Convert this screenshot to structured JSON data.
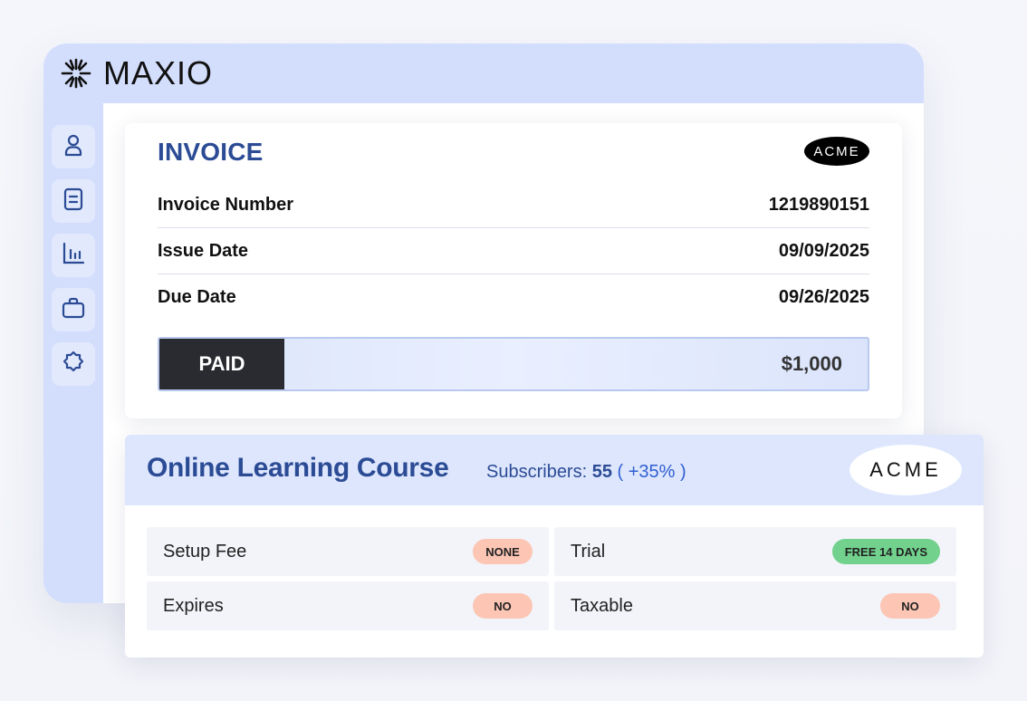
{
  "app": {
    "logo_text": "MAXIO",
    "sidebar_icons": [
      "user-icon",
      "document-icon",
      "chart-icon",
      "briefcase-icon",
      "settings-icon"
    ]
  },
  "invoice": {
    "title": "INVOICE",
    "brand": "ACME",
    "rows": [
      {
        "label": "Invoice Number",
        "value": "1219890151"
      },
      {
        "label": "Issue Date",
        "value": "09/09/2025"
      },
      {
        "label": "Due Date",
        "value": "09/26/2025"
      }
    ],
    "status": "PAID",
    "amount": "$1,000"
  },
  "course": {
    "title": "Online Learning Course",
    "subscribers_label": "Subscribers:",
    "subscribers_count": "55",
    "subscribers_delta": "( +35% )",
    "brand": "ACME",
    "attributes": [
      {
        "label": "Setup Fee",
        "badge": "NONE",
        "badge_color": "#fcc5b4"
      },
      {
        "label": "Trial",
        "badge": "FREE 14 DAYS",
        "badge_color": "#72d18d"
      },
      {
        "label": "Expires",
        "badge": "NO",
        "badge_color": "#fcc5b4"
      },
      {
        "label": "Taxable",
        "badge": "NO",
        "badge_color": "#fcc5b4"
      }
    ]
  },
  "colors": {
    "accent_blue": "#2b4b95",
    "window_bg": "#d3defd",
    "paid_dark": "#2a2b31"
  }
}
